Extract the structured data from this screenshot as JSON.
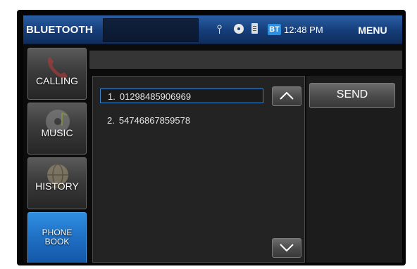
{
  "header": {
    "title": "BLUETOOTH",
    "bt_badge": "BT",
    "clock": "12:48 PM",
    "menu_label": "MENU",
    "status_icons": [
      "usb-icon",
      "disc-icon",
      "sd-card-icon",
      "bluetooth-badge"
    ]
  },
  "sidebar": {
    "items": [
      {
        "label": "CALLING",
        "icon": "phone-handset-icon"
      },
      {
        "label": "MUSIC",
        "icon": "music-disc-icon"
      },
      {
        "label": "HISTORY",
        "icon": "globe-icon"
      },
      {
        "label": "PHONE BOOK",
        "icon": "phonebook-icon",
        "active": true
      }
    ]
  },
  "phonebook": {
    "entries": [
      {
        "index": "1.",
        "number": "01298485906969",
        "selected": true
      },
      {
        "index": "2.",
        "number": "54746867859578",
        "selected": false
      }
    ],
    "send_label": "SEND"
  },
  "colors": {
    "topbar": "#153d78",
    "active_tab": "#1e6fc4",
    "selection_border": "#3a87d0",
    "bt_badge": "#2c8fe0"
  }
}
